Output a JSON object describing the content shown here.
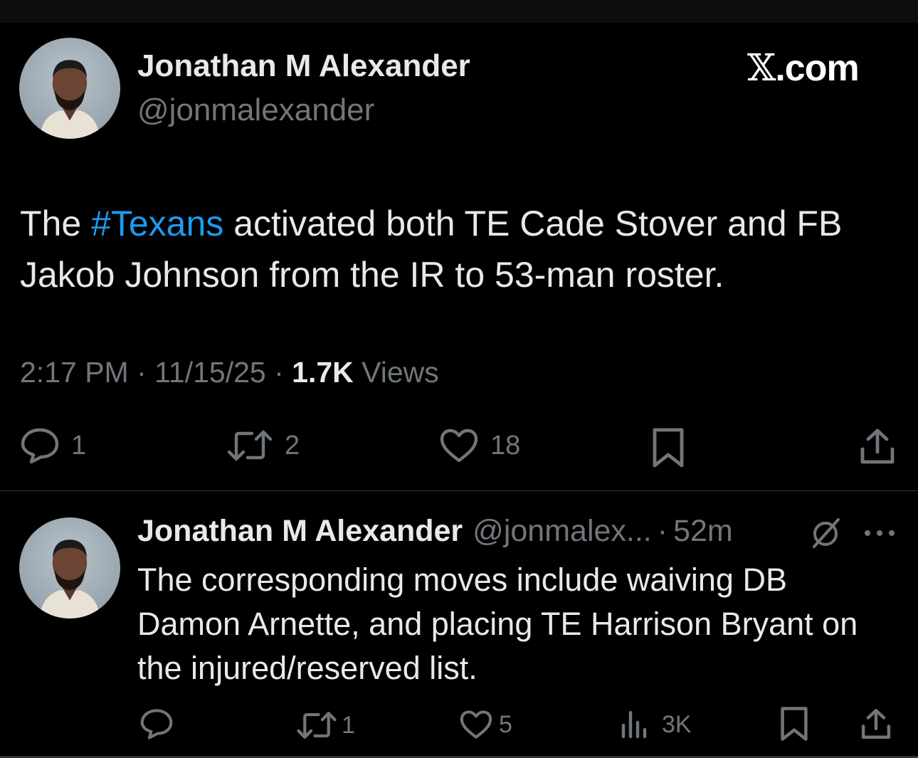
{
  "main_tweet": {
    "author_name": "Jonathan M Alexander",
    "author_handle": "@jonmalexander",
    "brand": ".com",
    "text_before": "The ",
    "hashtag": "#Texans",
    "text_after": " activated both TE Cade Stover and FB Jakob Johnson from the IR to 53-man roster.",
    "time": "2:17 PM",
    "date": "11/15/25",
    "views_count": "1.7K",
    "views_label": "Views",
    "replies": "1",
    "reposts": "2",
    "likes": "18"
  },
  "reply_tweet": {
    "author_name": "Jonathan M Alexander",
    "author_handle": "@jonmalex...",
    "time": "52m",
    "text": "The corresponding moves include waiving DB Damon Arnette, and placing TE Harrison Bryant on the injured/reserved list.",
    "replies": "",
    "reposts": "1",
    "likes": "5",
    "views": "3K"
  },
  "colors": {
    "background": "#000000",
    "text": "#e7e9ea",
    "secondary": "#71767b",
    "hashtag": "#1d9bf0",
    "divider": "#2f3336"
  },
  "icons": [
    "reply-icon",
    "repost-icon",
    "like-icon",
    "bookmark-icon",
    "share-icon",
    "views-icon",
    "grok-icon",
    "more-icon",
    "x-logo-icon"
  ]
}
